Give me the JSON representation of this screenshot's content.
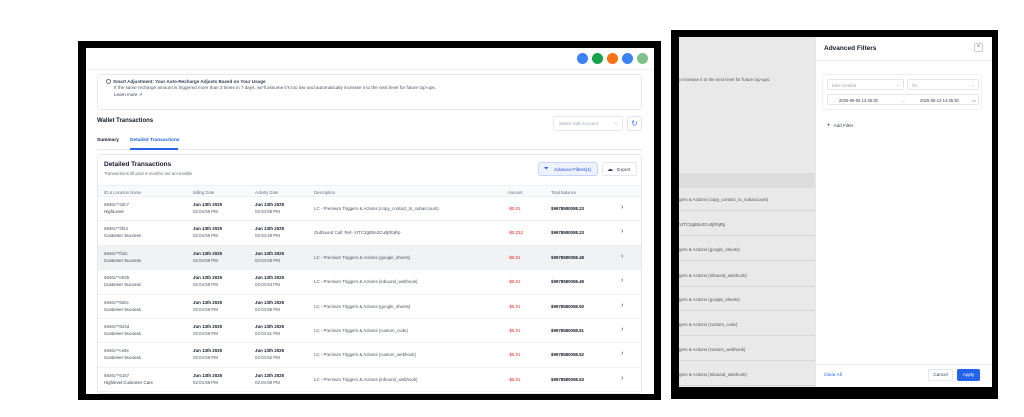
{
  "top_icons": [
    {
      "name": "link-icon",
      "color": "#3b82f6"
    },
    {
      "name": "phone-icon",
      "color": "#16a34a"
    },
    {
      "name": "notification-icon",
      "color": "#f97316"
    },
    {
      "name": "help-icon",
      "color": "#3b82f6"
    },
    {
      "name": "avatar",
      "color": "#7ec28a"
    }
  ],
  "smart_adjust": {
    "title": "Smart Adjustment: Your Auto-Recharge Adjusts Based on Your Usage",
    "body": "If the same recharge amount is triggered more than 3 times in 7 days, we'll assume it's too low and automatically increase it to the next level for future top-ups.",
    "learn_more": "Learn more"
  },
  "wallet": {
    "title": "Wallet Transactions",
    "subaccount_placeholder": "Select Sub Account",
    "tabs": {
      "summary": "Summary",
      "detailed": "Detailed Transactions"
    }
  },
  "detailed": {
    "title": "Detailed Transactions",
    "subtitle": "Transactions till past 6 months are accessible",
    "advance_filters": "Advance Filters(1)",
    "export": "Export",
    "columns": {
      "id": "ID & Location Name",
      "billing": "Billing Date",
      "activity": "Activity Date",
      "description": "Description",
      "amount": "Amount",
      "balance": "Total Balance"
    },
    "rows": [
      {
        "id": "6846c**4dc7",
        "account": "HighLevel",
        "bdate": "Jun 13th 2025",
        "btime": "02:04:59 PM",
        "adate": "Jun 13th 2025",
        "atime": "02:04:59 PM",
        "desc": "LC - Premium Triggers & Actions (copy_contact_to_subaccount)",
        "amount": "-$0.01",
        "balance": "$9978580058.23"
      },
      {
        "id": "6846c**3f24",
        "account": "Customer Success",
        "bdate": "Jun 13th 2025",
        "btime": "02:04:59 PM",
        "adate": "Jun 13th 2025",
        "atime": "02:04:49 PM",
        "desc": "Outbound Call: Ref- VITC2gB0e2Cu0jRbjRp",
        "amount": "-$0.232",
        "balance": "$9978580058.23"
      },
      {
        "id": "6846c**f1dc",
        "account": "Customer Success",
        "bdate": "Jun 13th 2025",
        "btime": "02:04:59 PM",
        "adate": "Jun 13th 2025",
        "atime": "02:04:59 PM",
        "desc": "LC - Premium Triggers & Actions (google_sheets)",
        "amount": "-$0.01",
        "balance": "$9978580058.48"
      },
      {
        "id": "6846c**e835",
        "account": "Customer Success",
        "bdate": "Jun 13th 2025",
        "btime": "02:04:59 PM",
        "adate": "Jun 13th 2025",
        "atime": "02:04:53 PM",
        "desc": "LC - Premium Triggers & Actions (inbound_webhook)",
        "amount": "-$0.01",
        "balance": "$9978580058.49"
      },
      {
        "id": "6846c**826c",
        "account": "Customer Success",
        "bdate": "Jun 13th 2025",
        "btime": "02:04:59 PM",
        "adate": "Jun 13th 2025",
        "atime": "02:04:59 PM",
        "desc": "LC - Premium Triggers & Actions (google_sheets)",
        "amount": "-$0.01",
        "balance": "$9978580058.50"
      },
      {
        "id": "6846c**824d",
        "account": "Customer Success",
        "bdate": "Jun 13th 2025",
        "btime": "02:04:59 PM",
        "adate": "Jun 13th 2025",
        "atime": "02:04:51 PM",
        "desc": "LC - Premium Triggers & Actions (custom_code)",
        "amount": "-$0.01",
        "balance": "$9978580058.51"
      },
      {
        "id": "6846c**ce8e",
        "account": "Customer Success",
        "bdate": "Jun 13th 2025",
        "btime": "02:04:59 PM",
        "adate": "Jun 13th 2025",
        "atime": "02:04:52 PM",
        "desc": "LC - Premium Triggers & Actions (custom_webhook)",
        "amount": "-$0.01",
        "balance": "$9978580058.52"
      },
      {
        "id": "6846c**6157",
        "account": "Highlevel Customer Care",
        "bdate": "Jun 13th 2025",
        "btime": "02:04:59 PM",
        "adate": "Jun 13th 2025",
        "atime": "02:04:59 PM",
        "desc": "LC - Premium Triggers & Actions (inbound_webhook)",
        "amount": "-$0.01",
        "balance": "$9978580058.53"
      }
    ]
  },
  "background_right": {
    "texts": [
      "y increase it to the next level for future top-ups.",
      "gers & Actions (copy_contact_to_subaccount)",
      "VITC2gB0e2Cu0jRbjRp",
      "gers & Actions (google_sheets)",
      "gers & Actions (inbound_webhook)",
      "gers & Actions (google_sheets)",
      "gers & Actions (custom_code)",
      "gers & Actions (custom_webhook)",
      "gers & Actions (inbound_webhook)"
    ]
  },
  "advanced_filters": {
    "title": "Advanced Filters",
    "field_placeholder": "Date created",
    "operator_placeholder": "On",
    "start_date": "2025-06-06 14:35:30",
    "end_date": "2025-06-13 14:35:30",
    "add_filter": "Add Filter",
    "clear_all": "Clear All",
    "cancel": "Cancel",
    "apply": "Apply"
  }
}
